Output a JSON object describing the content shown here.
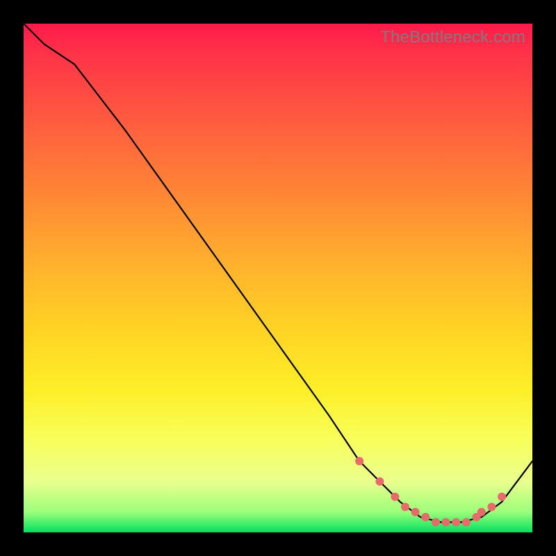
{
  "watermark": "TheBottleneck.com",
  "colors": {
    "curve_stroke": "#000000",
    "marker_fill": "#e86a6a",
    "marker_stroke": "#e86a6a"
  },
  "chart_data": {
    "type": "line",
    "title": "",
    "xlabel": "",
    "ylabel": "",
    "xlim": [
      0,
      100
    ],
    "ylim": [
      0,
      100
    ],
    "grid": false,
    "legend": false,
    "series": [
      {
        "name": "bottleneck-curve",
        "x": [
          0,
          4,
          10,
          20,
          30,
          40,
          50,
          60,
          66,
          70,
          74,
          78,
          82,
          86,
          90,
          94,
          100
        ],
        "y": [
          100,
          96,
          92,
          79,
          65,
          51,
          37,
          23,
          14,
          10,
          6,
          3,
          2,
          2,
          3,
          6,
          14
        ]
      }
    ],
    "markers": {
      "name": "highlight-points",
      "x": [
        66,
        70,
        73,
        75,
        77,
        79,
        81,
        83,
        85,
        87,
        89,
        90,
        92,
        94
      ],
      "y": [
        14,
        10,
        7,
        5,
        4,
        3,
        2,
        2,
        2,
        2,
        3,
        4,
        5,
        7
      ]
    }
  }
}
